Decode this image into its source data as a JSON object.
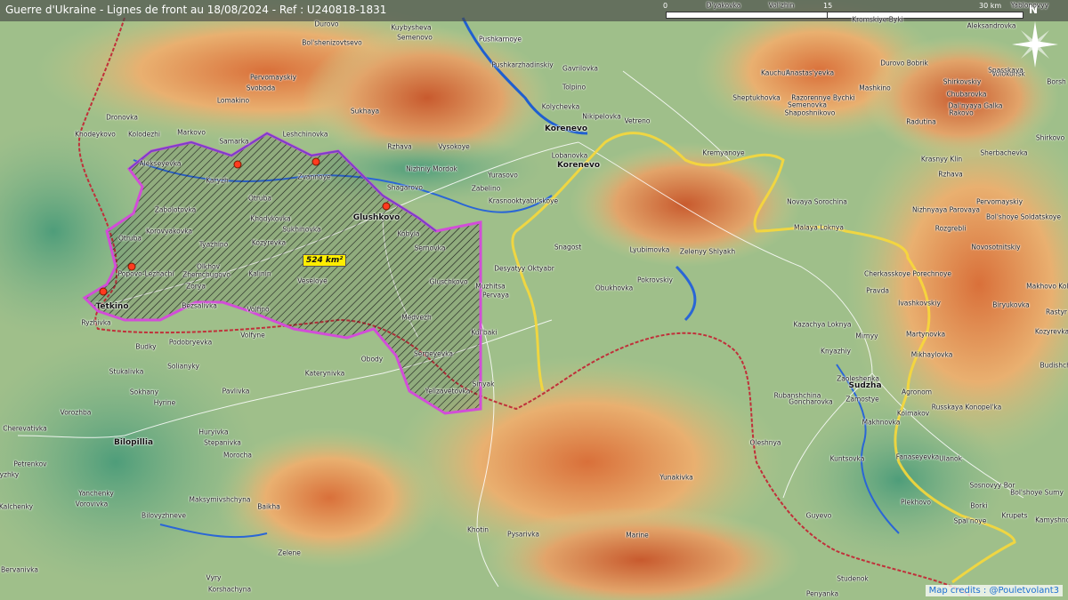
{
  "header": {
    "title": "Guerre d'Ukraine - Lignes de front au 18/08/2024 - Ref : U240818-1831"
  },
  "scale": {
    "labels": [
      "0",
      "15",
      "30 km"
    ]
  },
  "compass": {
    "label": "N"
  },
  "occupied_area": {
    "label": "524 km²"
  },
  "credits": "Map credits : @Pouletvolant3",
  "places": [
    {
      "name": "Guerre",
      "skip": true
    },
    {
      "name": "D'yakovka"
    },
    {
      "name": "Vol'zhin"
    },
    {
      "name": "Yablonovyy"
    },
    {
      "name": "Kuybysheva"
    },
    {
      "name": "Semenovo"
    },
    {
      "name": "Durovo"
    },
    {
      "name": "Pushkarnoye"
    },
    {
      "name": "Bol'shenizovtsevo"
    },
    {
      "name": "Pushkarnoye"
    },
    {
      "name": "Pushkarzhadinskiy"
    },
    {
      "name": "Gavrilovka"
    },
    {
      "name": "Tolpino"
    },
    {
      "name": "Pervomayskiy"
    },
    {
      "name": "Svoboda"
    },
    {
      "name": "Lomakino"
    },
    {
      "name": "Sukhaya"
    },
    {
      "name": "Kolychevka"
    },
    {
      "name": "Nikipelovka"
    },
    {
      "name": "Vetreno"
    },
    {
      "name": "Korenevo"
    },
    {
      "name": "Lobanovka"
    },
    {
      "name": "Korenevo"
    },
    {
      "name": "Dronovka"
    },
    {
      "name": "Khodeykovo"
    },
    {
      "name": "Kolodezhi"
    },
    {
      "name": "Markovo"
    },
    {
      "name": "Leshchinovka"
    },
    {
      "name": "Samarka"
    },
    {
      "name": "Rzhava"
    },
    {
      "name": "Vysokoye"
    },
    {
      "name": "Alekseyevka"
    },
    {
      "name": "Karyzh"
    },
    {
      "name": "Zvannoye"
    },
    {
      "name": "Nizhniy Mordok"
    },
    {
      "name": "Yurasovo"
    },
    {
      "name": "Zabelino"
    },
    {
      "name": "Shagarovo"
    },
    {
      "name": "Krasnooktyabr'skoye"
    },
    {
      "name": "Otruba"
    },
    {
      "name": "Zabolotovka"
    },
    {
      "name": "Khodykovka"
    },
    {
      "name": "Glushkovo"
    },
    {
      "name": "Kobyla"
    },
    {
      "name": "Korovyakovka"
    },
    {
      "name": "Sukhinovka"
    },
    {
      "name": "Sernovka"
    },
    {
      "name": "Tyazhino"
    },
    {
      "name": "Kozyrevka"
    },
    {
      "name": "Otruba"
    },
    {
      "name": "Popovo-Lezhachi"
    },
    {
      "name": "Olkhov"
    },
    {
      "name": "Zhemchugovo"
    },
    {
      "name": "Kalinin"
    },
    {
      "name": "Veseloye"
    },
    {
      "name": "Gluschkovo"
    },
    {
      "name": "Zorya"
    },
    {
      "name": "Tetkino"
    },
    {
      "name": "Bezsalivka"
    },
    {
      "name": "Volfino"
    },
    {
      "name": "Medvezh"
    },
    {
      "name": "Ryzhivka"
    },
    {
      "name": "Budky"
    },
    {
      "name": "Volfyne"
    },
    {
      "name": "Podobryevka"
    },
    {
      "name": "Sergeyevka"
    },
    {
      "name": "Obody"
    },
    {
      "name": "Stukalivka"
    },
    {
      "name": "Solianyky"
    },
    {
      "name": "Katerynivka"
    },
    {
      "name": "Sokhany"
    },
    {
      "name": "Pavlivka"
    },
    {
      "name": "Hyrine"
    },
    {
      "name": "Yelizavetovka"
    },
    {
      "name": "Sinyak"
    },
    {
      "name": "Muzhitsa"
    },
    {
      "name": "Pervaya"
    },
    {
      "name": "Kul'baki"
    },
    {
      "name": "Desyatyy Oktyabr"
    },
    {
      "name": "Snagost"
    },
    {
      "name": "Lyubimovka"
    },
    {
      "name": "Zelenyy Shlyakh"
    },
    {
      "name": "Obukhovka"
    },
    {
      "name": "Pokrovskiy"
    },
    {
      "name": "Kremyanoye"
    },
    {
      "name": "Novaya Sorochina"
    },
    {
      "name": "Malaya Loknya"
    },
    {
      "name": "Vorozhba"
    },
    {
      "name": "Cherevativka"
    },
    {
      "name": "Bilopillia"
    },
    {
      "name": "Petrenkov"
    },
    {
      "name": "Huryivka"
    },
    {
      "name": "Stepanivka"
    },
    {
      "name": "Morocha"
    },
    {
      "name": "Yanchenky"
    },
    {
      "name": "Vorovivka"
    },
    {
      "name": "Kalchenky"
    },
    {
      "name": "Maksymivshchyna"
    },
    {
      "name": "Bilovyzhneve"
    },
    {
      "name": "Baikha"
    },
    {
      "name": "Zelene"
    },
    {
      "name": "Ryzhky"
    },
    {
      "name": "Vyry"
    },
    {
      "name": "Korshachyna"
    },
    {
      "name": "Bervanivka"
    },
    {
      "name": "Yunakivka"
    },
    {
      "name": "Oleshnya"
    },
    {
      "name": "Khotin"
    },
    {
      "name": "Pysarivka"
    },
    {
      "name": "Marine"
    },
    {
      "name": "Guyevo"
    },
    {
      "name": "Plekhovo"
    },
    {
      "name": "Borki"
    },
    {
      "name": "Spal'noye"
    },
    {
      "name": "Krupets"
    },
    {
      "name": "Kamyshnoe"
    },
    {
      "name": "Studenok"
    },
    {
      "name": "Penyanka"
    },
    {
      "name": "Sudzha"
    },
    {
      "name": "Zamostye"
    },
    {
      "name": "Goncharovka"
    },
    {
      "name": "Rubanshchina"
    },
    {
      "name": "Zaoleshenka"
    },
    {
      "name": "Knyazhiy"
    },
    {
      "name": "Kazachya Loknya"
    },
    {
      "name": "Mirnyy"
    },
    {
      "name": "Makhnovka"
    },
    {
      "name": "Agronom"
    },
    {
      "name": "Kolmakov"
    },
    {
      "name": "Russkaya Konopel'ka"
    },
    {
      "name": "Mikhaylovka"
    },
    {
      "name": "Martynovka"
    },
    {
      "name": "Ivashkovskiy"
    },
    {
      "name": "Pravda"
    },
    {
      "name": "Cherkasskoye Porechnoye"
    },
    {
      "name": "Fanaseyevka"
    },
    {
      "name": "Ulanok"
    },
    {
      "name": "Sosnovyy Bor"
    },
    {
      "name": "Kuntsovka"
    },
    {
      "name": "Kromskiye Byki"
    },
    {
      "name": "Kauchuk"
    },
    {
      "name": "Anastas'yevka"
    },
    {
      "name": "Razorennye Bychki"
    },
    {
      "name": "Mashkino"
    },
    {
      "name": "Sheptukhovka"
    },
    {
      "name": "Semenovka"
    },
    {
      "name": "Shaposhnikovo"
    },
    {
      "name": "Durovo Bobrik"
    },
    {
      "name": "Shirkovskiy"
    },
    {
      "name": "Volokonsk"
    },
    {
      "name": "Chubarovka"
    },
    {
      "name": "Spasskaya"
    },
    {
      "name": "Dal'nyaya Galka"
    },
    {
      "name": "Rakovo"
    },
    {
      "name": "Radutina"
    },
    {
      "name": "Shirkovo"
    },
    {
      "name": "Krasnyy Klin"
    },
    {
      "name": "Rzhava"
    },
    {
      "name": "Sherbachevka"
    },
    {
      "name": "Nizhnyaya Parovaya"
    },
    {
      "name": "Pervomayskiy"
    },
    {
      "name": "Bol'shoye Soldatskoye"
    },
    {
      "name": "Rozgrebli"
    },
    {
      "name": "Novosotnitskiy"
    },
    {
      "name": "Makhovo Kolodezy"
    },
    {
      "name": "Biryukovka"
    },
    {
      "name": "Rastyr"
    },
    {
      "name": "Kozyrevka"
    },
    {
      "name": "Budishche"
    },
    {
      "name": "Bol'shoye Sumy"
    },
    {
      "name": "Aleksandrovka"
    },
    {
      "name": "Borsh"
    }
  ],
  "colors": {
    "russia_border": "#c0303a",
    "frontline_kursk": "#f7d83a",
    "occupied_glushkovo": "#d24dd8"
  }
}
